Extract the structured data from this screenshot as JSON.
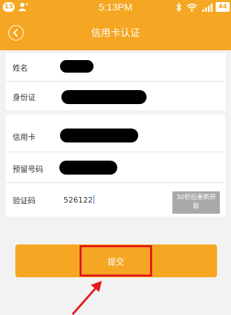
{
  "status_bar": {
    "notification_count": "13",
    "time": "5:13PM",
    "battery": "44"
  },
  "header": {
    "title": "信用卡认证"
  },
  "form": {
    "name_label": "姓名",
    "id_label": "身份证",
    "card_label": "信用卡",
    "phone_label": "预留号码",
    "code_label": "验证码",
    "code_value": "526122",
    "resend_line1": "30秒后重新获",
    "resend_line2": "取"
  },
  "submit": {
    "label": "提交"
  },
  "colors": {
    "accent": "#f5a623",
    "highlight": "#e31b1b",
    "disabled": "#a9a9a9"
  }
}
